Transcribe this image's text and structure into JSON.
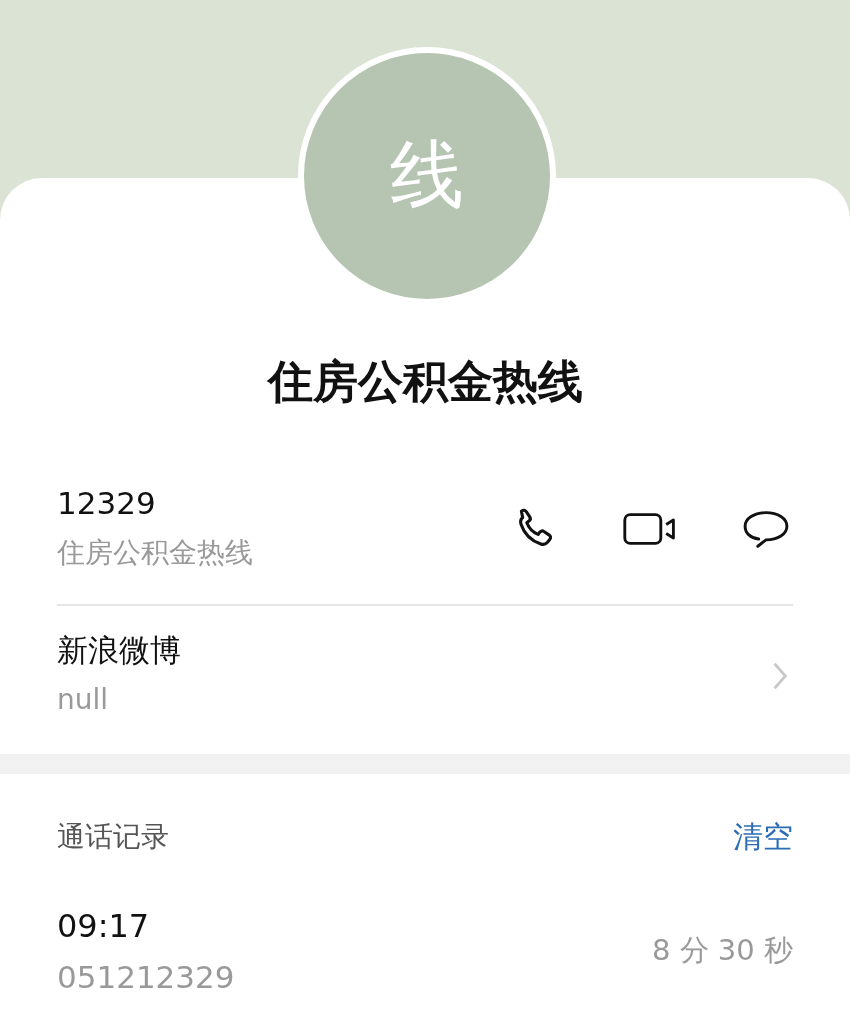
{
  "avatar": {
    "initial": "线"
  },
  "contact_name": "住房公积金热线",
  "entries": [
    {
      "kind": "phone",
      "value": "12329",
      "label": "住房公积金热线"
    },
    {
      "kind": "link",
      "value": "新浪微博",
      "label": "null"
    }
  ],
  "call_log": {
    "title": "通话记录",
    "clear_button": "清空",
    "calls": [
      {
        "time": "09:17",
        "duration": "8 分 30 秒",
        "number": "051212329"
      }
    ]
  }
}
